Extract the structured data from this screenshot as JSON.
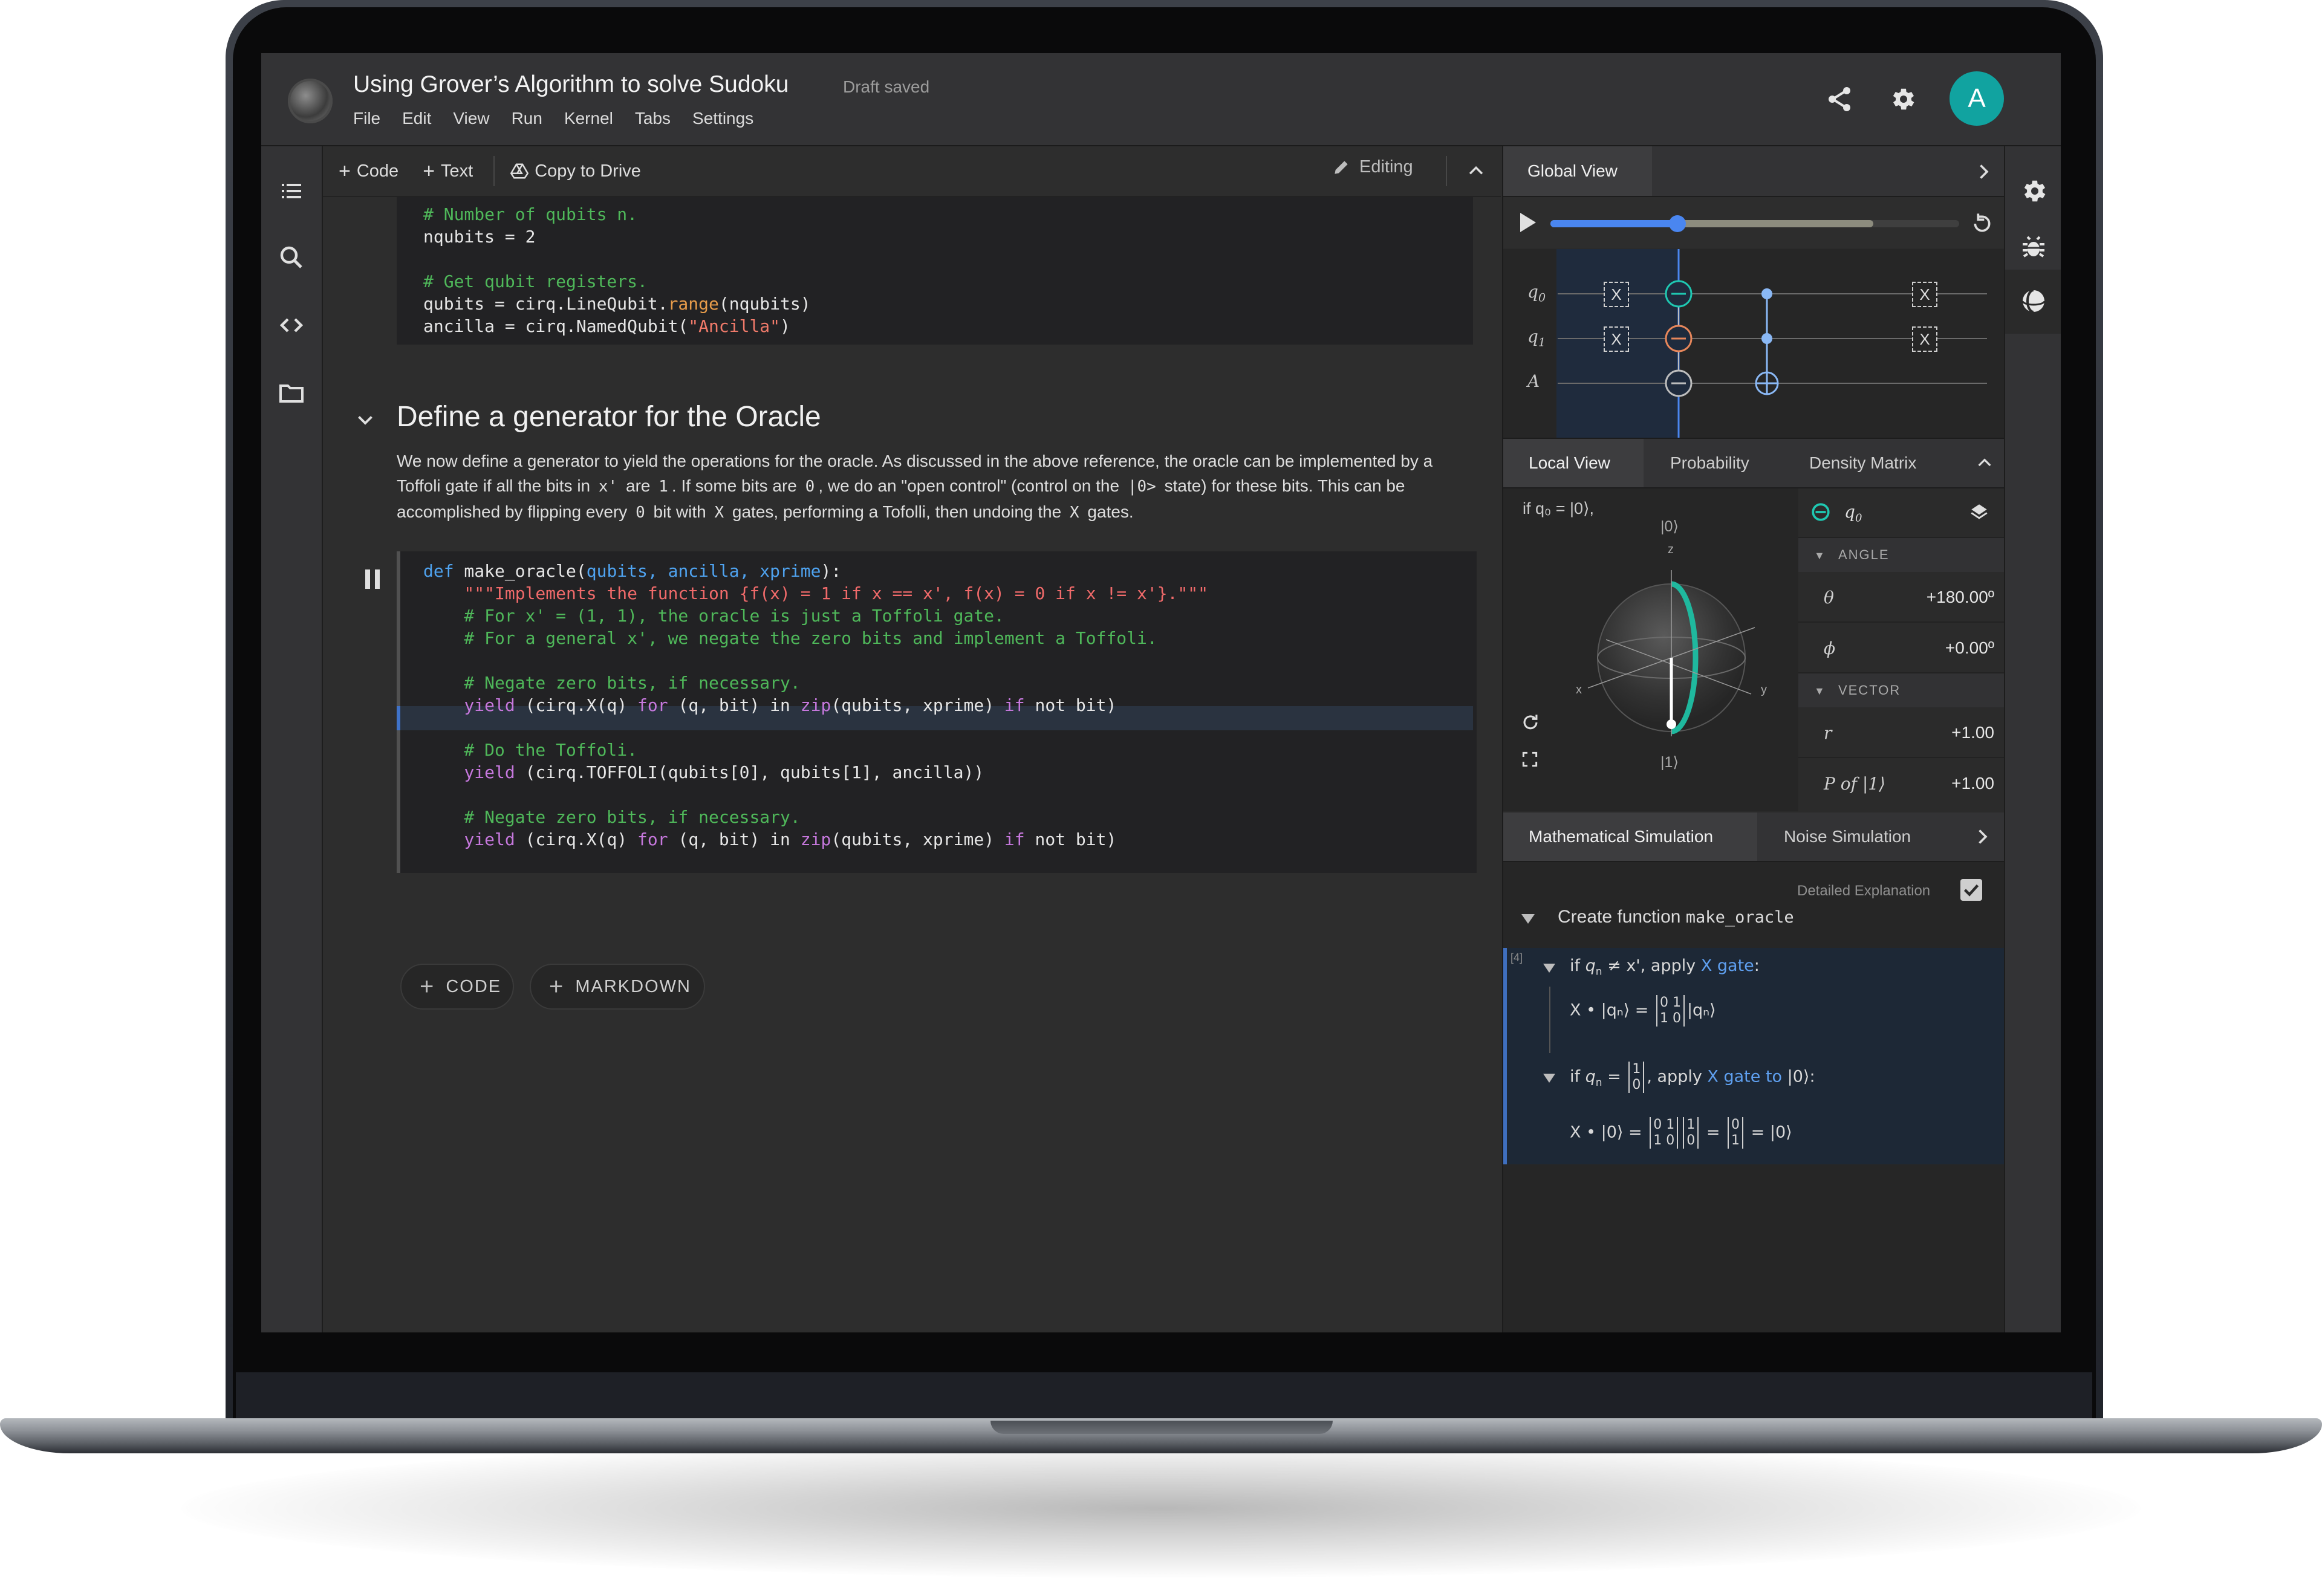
{
  "header": {
    "title": "Using Grover’s Algorithm to solve Sudoku",
    "status": "Draft saved",
    "menu": [
      "File",
      "Edit",
      "View",
      "Run",
      "Kernel",
      "Tabs",
      "Settings"
    ],
    "avatar_letter": "A",
    "icons": [
      "share-icon",
      "settings-icon"
    ]
  },
  "left_rail": {
    "icons": [
      "list-icon",
      "search-icon",
      "code-icon",
      "folder-icon"
    ]
  },
  "toolbar": {
    "add_code": "Code",
    "add_text": "Text",
    "copy_to_drive": "Copy to Drive",
    "editing": "Editing"
  },
  "cell1": {
    "lines": [
      "# Number of qubits n.",
      "nqubits = 2",
      "",
      "# Get qubit registers.",
      "qubits = cirq.LineQubit.range(nqubits)",
      "ancilla = cirq.NamedQubit(\"Ancilla\")"
    ]
  },
  "section": {
    "title": "Define a generator for the Oracle",
    "paragraph": {
      "p1": "We now define a generator to yield the operations for the oracle. As discussed in the above reference, the oracle can be implemented by a Toffoli gate if all the bits in",
      "c1": "x'",
      "p2": "are",
      "c2": "1",
      "p3": ". If some bits are",
      "c3": "0",
      "p4": ", we do an \"open control\" (control on the",
      "c4": "|0>",
      "p5": "state) for these bits. This can be accomplished by flipping every",
      "c5": "0",
      "p6": "bit with",
      "c6": "X",
      "p7": "gates, performing a Tofolli, then undoing the",
      "c7": "X",
      "p8": "gates."
    }
  },
  "cell2": {
    "lines": [
      "def make_oracle(qubits, ancilla, xprime):",
      "    \"\"\"Implements the function {f(x) = 1 if x == x', f(x) = 0 if x != x'}.\"\"\"",
      "    # For x' = (1, 1), the oracle is just a Toffoli gate.",
      "    # For a general x', we negate the zero bits and implement a Toffoli.",
      "",
      "    # Negate zero bits, if necessary.",
      "    yield (cirq.X(q) for (q, bit) in zip(qubits, xprime) if not bit)",
      "",
      "    # Do the Toffoli.",
      "    yield (cirq.TOFFOLI(qubits[0], qubits[1], ancilla))",
      "",
      "    # Negate zero bits, if necessary.",
      "    yield (cirq.X(q) for (q, bit) in zip(qubits, xprime) if not bit)"
    ]
  },
  "add_buttons": {
    "code": "CODE",
    "markdown": "MARKDOWN"
  },
  "global_view": {
    "tab": "Global View",
    "progress": 0.31,
    "buffered": 0.79,
    "qubit_labels": [
      "q",
      "q",
      "A"
    ],
    "qubit_subscripts": [
      "0",
      "1",
      ""
    ],
    "gate_label": "X"
  },
  "local_view": {
    "tabs": [
      "Local View",
      "Probability",
      "Density Matrix"
    ],
    "condition": "if q₀ = |0⟩,",
    "bloch": {
      "top": "|0⟩",
      "bottom": "|1⟩",
      "z": "z",
      "x": "x",
      "y": "y"
    },
    "qubit": "q",
    "qubit_sub": "0",
    "angle_header": "ANGLE",
    "theta_symbol": "θ",
    "theta": "+180.00º",
    "phi_symbol": "ϕ",
    "phi": "+0.00º",
    "vector_header": "VECTOR",
    "r_symbol": "r",
    "r": "+1.00",
    "p_label": "P of |1⟩",
    "p": "+1.00"
  },
  "simulation": {
    "tabs": [
      "Mathematical Simulation",
      "Noise Simulation"
    ],
    "detailed_label": "Detailed Explanation",
    "detailed_checked": true,
    "create_prefix": "Create function",
    "create_fn": "make_oracle",
    "step_index": "[4]",
    "step1_if": "if",
    "step1_cond": "q",
    "step1_sub": "n",
    "step1_neq": "≠ x',",
    "step1_apply": "apply",
    "step1_gate": "X gate",
    "step1_colon": ":",
    "step2_if": "if",
    "step2_apply": ", apply",
    "step2_gate": "X gate to",
    "step2_ket": "|0⟩:",
    "x_op": "X •",
    "eq": "=",
    "ket_qn": "|qₙ⟩",
    "ket0": "|0⟩"
  },
  "right_rail": {
    "icons": [
      "settings-icon",
      "bug-icon",
      "bloch-sphere-icon"
    ]
  },
  "colors": {
    "accent_blue": "#4a86f0",
    "teal": "#1fc8b2",
    "orange": "#e8875b",
    "avatar": "#11a3a0"
  }
}
